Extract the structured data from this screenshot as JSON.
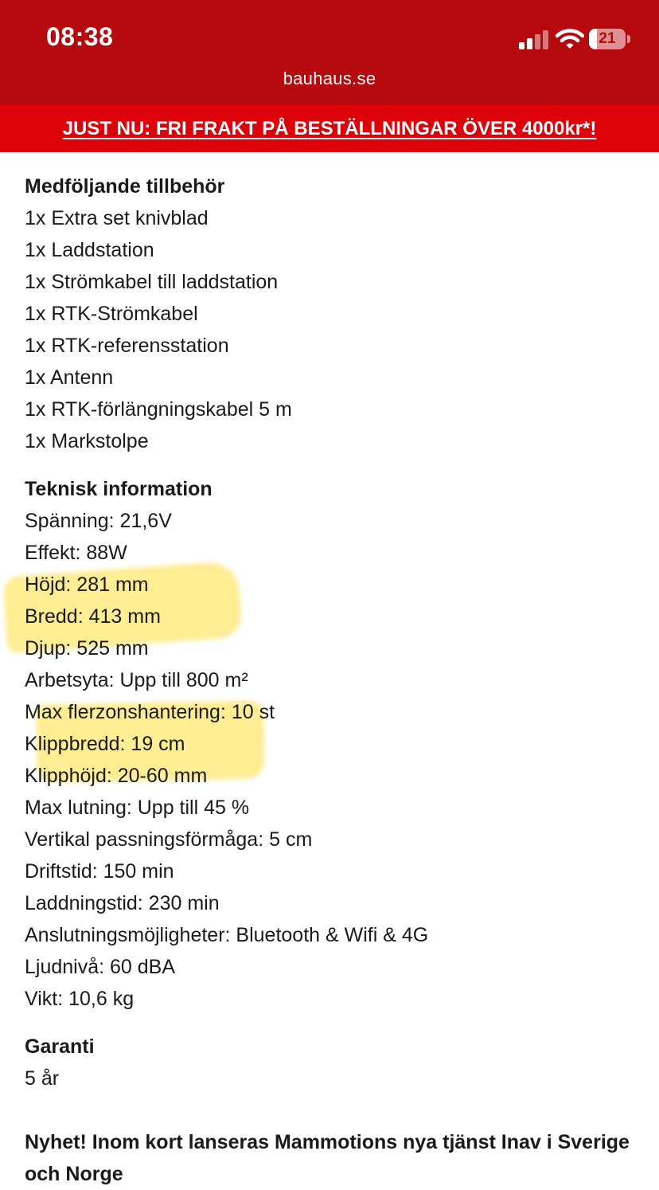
{
  "status_bar": {
    "time": "08:38",
    "battery_level": "21",
    "url": "bauhaus.se",
    "signal_icon": "cellular-signal-icon",
    "wifi_icon": "wifi-icon",
    "battery_icon": "battery-icon"
  },
  "promo": {
    "text": "JUST NU: FRI FRAKT PÅ BESTÄLLNINGAR ÖVER 4000kr*!"
  },
  "accessories": {
    "heading": "Medföljande tillbehör",
    "items": [
      "1x Extra set knivblad",
      "1x Laddstation",
      "1x Strömkabel till laddstation",
      "1x RTK-Strömkabel",
      "1x RTK-referensstation",
      "1x Antenn",
      "1x RTK-förlängningskabel 5 m",
      "1x Markstolpe"
    ]
  },
  "technical": {
    "heading": "Teknisk information",
    "items": [
      "Spänning: 21,6V",
      "Effekt: 88W",
      "Höjd: 281 mm",
      "Bredd: 413 mm",
      "Djup: 525 mm",
      "Arbetsyta: Upp till 800 m²",
      "Max flerzonshantering: 10 st",
      "Klippbredd: 19 cm",
      "Klipphöjd: 20-60 mm",
      "Max lutning: Upp till 45 %",
      "Vertikal passningsförmåga: 5 cm",
      "Driftstid: 150 min",
      "Laddningstid: 230 min",
      "Anslutningsmöjligheter: Bluetooth & Wifi & 4G",
      "Ljudnivå: 60 dBA",
      "Vikt: 10,6 kg"
    ]
  },
  "warranty": {
    "heading": "Garanti",
    "value": "5 år"
  },
  "news": {
    "text": "Nyhet! Inom kort lanseras Mammotions nya tjänst Inav i Sverige och Norge"
  },
  "colors": {
    "status_bar_bg": "#b5090e",
    "promo_bg": "#dd0209",
    "highlight": "#ffdc28",
    "text": "#1a1a1a"
  }
}
